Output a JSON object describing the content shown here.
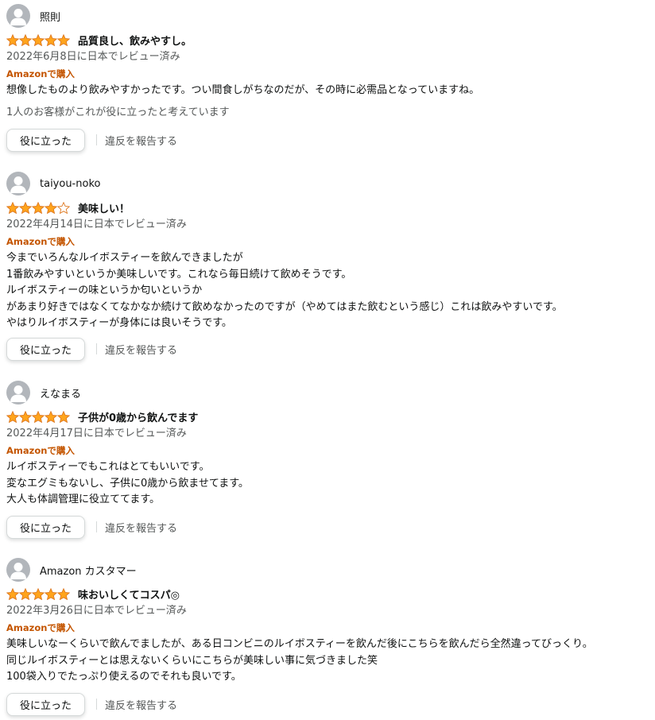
{
  "colors": {
    "star": "#ffa41c",
    "star_outline": "#de7921",
    "badge": "#c45500",
    "muted": "#565959"
  },
  "reviews": [
    {
      "reviewer": "照則",
      "rating": 5,
      "title": "品質良し、飲みやすし。",
      "date": "2022年6月8日に日本でレビュー済み",
      "badge": "Amazonで購入",
      "body": [
        "想像したものより飲みやすかったです。つい間食しがちなのだが、その時に必需品となっていますね。"
      ],
      "helpful_count_text": "1人のお客様がこれが役に立ったと考えています",
      "helpful_button": "役に立った",
      "report_link": "違反を報告する"
    },
    {
      "reviewer": "taiyou-noko",
      "rating": 4,
      "title": "美味しい！",
      "date": "2022年4月14日に日本でレビュー済み",
      "badge": "Amazonで購入",
      "body": [
        "今までいろんなルイボスティーを飲んできましたが",
        "1番飲みやすいというか美味しいです。これなら毎日続けて飲めそうです。",
        "ルイボスティーの味というか匂いというか",
        "があまり好きではなくてなかなか続けて飲めなかったのですが（やめてはまた飲むという感じ）これは飲みやすいです。",
        "やはりルイボスティーが身体には良いそうです。"
      ],
      "helpful_count_text": "",
      "helpful_button": "役に立った",
      "report_link": "違反を報告する"
    },
    {
      "reviewer": "えなまる",
      "rating": 5,
      "title": "子供が0歳から飲んでます",
      "date": "2022年4月17日に日本でレビュー済み",
      "badge": "Amazonで購入",
      "body": [
        "ルイボスティーでもこれはとてもいいです。",
        "変なエグミもないし、子供に0歳から飲ませてます。",
        "大人も体調管理に役立ててます。"
      ],
      "helpful_count_text": "",
      "helpful_button": "役に立った",
      "report_link": "違反を報告する"
    },
    {
      "reviewer": "Amazon カスタマー",
      "rating": 5,
      "title": "味おいしくてコスパ◎",
      "date": "2022年3月26日に日本でレビュー済み",
      "badge": "Amazonで購入",
      "body": [
        "美味しいなーくらいで飲んでましたが、ある日コンビニのルイボスティーを飲んだ後にこちらを飲んだら全然違ってびっくり。",
        "同じルイボスティーとは思えないくらいにこちらが美味しい事に気づきました笑",
        "100袋入りでたっぷり使えるのでそれも良いです。"
      ],
      "helpful_count_text": "",
      "helpful_button": "役に立った",
      "report_link": "違反を報告する"
    }
  ]
}
